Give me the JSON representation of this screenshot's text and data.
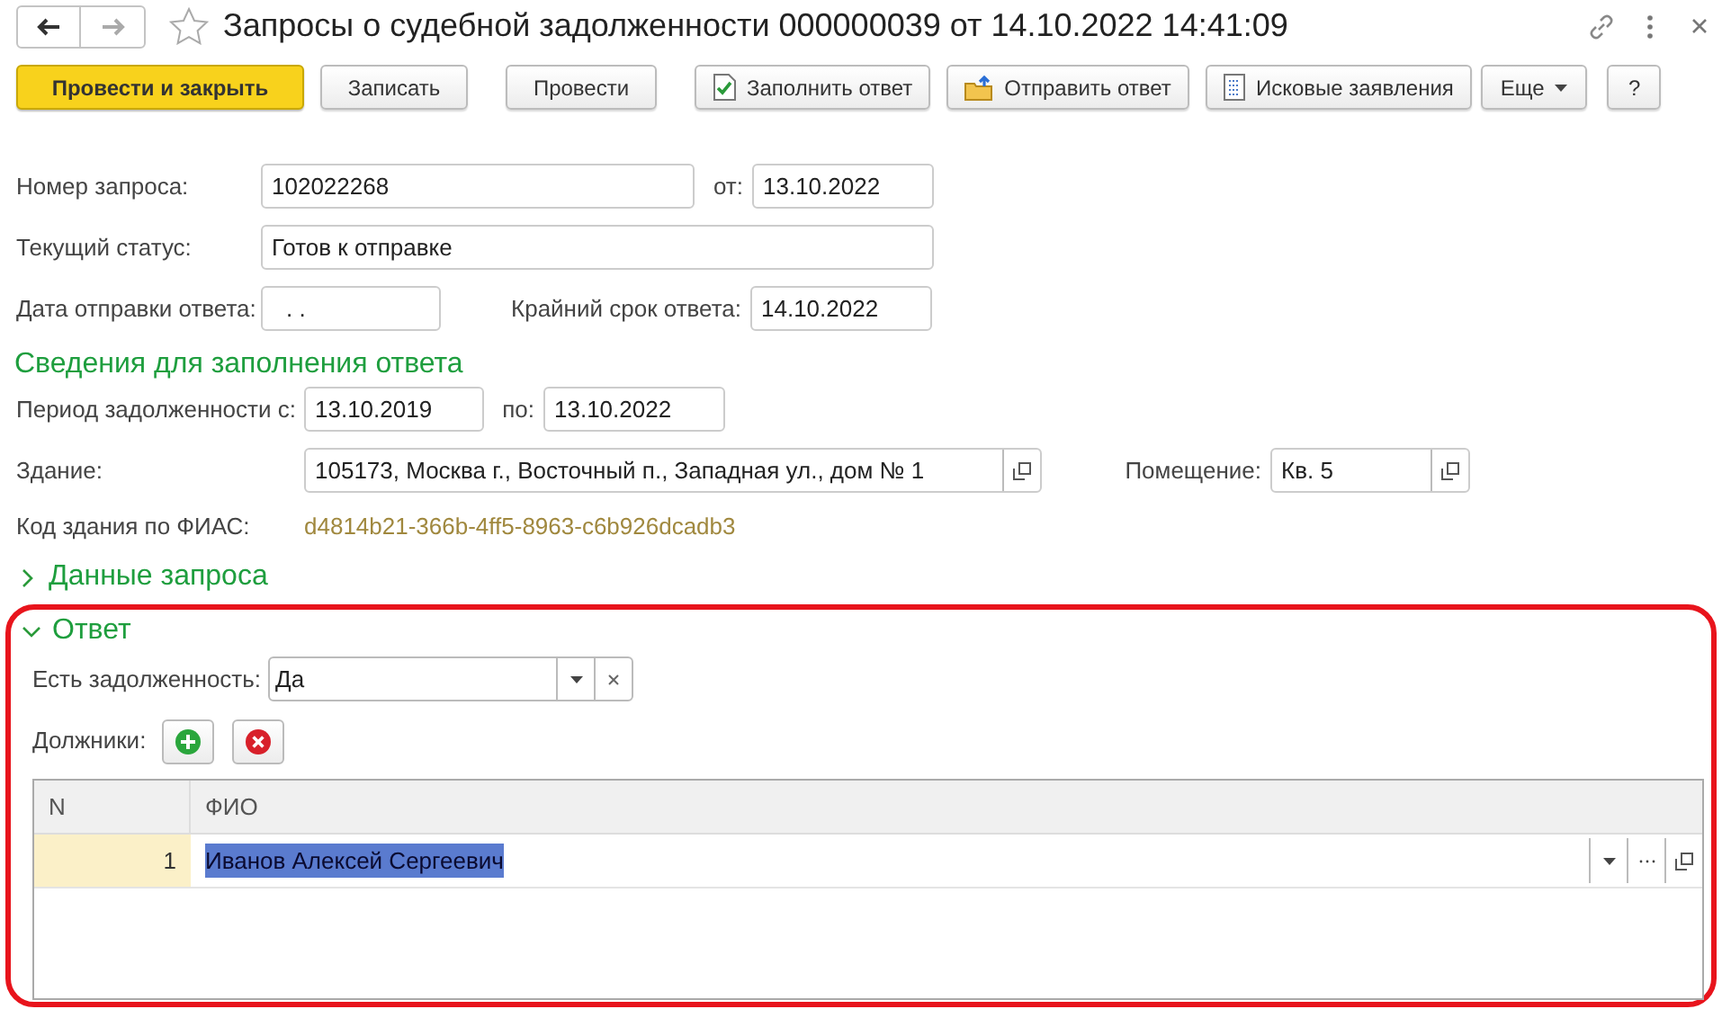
{
  "window": {
    "title": "Запросы о судебной задолженности 000000039 от 14.10.2022 14:41:09",
    "favorite": false
  },
  "toolbar": [
    {
      "label": "Провести и закрыть",
      "kind": "primary"
    },
    {
      "label": "Записать",
      "kind": "plain"
    },
    {
      "label": "Провести",
      "kind": "plain"
    },
    {
      "label": "Заполнить ответ",
      "kind": "fill"
    },
    {
      "label": "Отправить ответ",
      "kind": "send"
    },
    {
      "label": "Исковые заявления",
      "kind": "claims"
    },
    {
      "label": "Еще",
      "kind": "more"
    },
    {
      "label": "?",
      "kind": "help"
    }
  ],
  "request": {
    "number_label": "Номер запроса:",
    "number": "102022268",
    "date_label": "от:",
    "date": "13.10.2022",
    "status_label": "Текущий статус:",
    "status": "Готов к отправке",
    "sent_label": "Дата отправки ответа:",
    "sent": ". .",
    "deadline_label": "Крайний срок ответа:",
    "deadline": "14.10.2022"
  },
  "details": {
    "title": "Сведения для заполнения ответа",
    "period_label": "Период задолженности с:",
    "period_from": "13.10.2019",
    "to_label": "по:",
    "period_to": "13.10.2022",
    "building_label": "Здание:",
    "building": "105173, Москва г., Восточный п., Западная ул., дом № 1",
    "room_label": "Помещение:",
    "room": "Кв. 5",
    "fias_label": "Код здания по ФИАС:",
    "fias": "d4814b21-366b-4ff5-8963-c6b926dcadb3"
  },
  "request_data": {
    "title": "Данные запроса",
    "expanded": false
  },
  "answer": {
    "title": "Ответ",
    "expanded": true,
    "debt_label": "Есть задолженность:",
    "debt": "Да",
    "debtors_label": "Должники:",
    "table": {
      "columns": [
        "N",
        "ФИО"
      ],
      "rows": [
        {
          "n": "1",
          "name": "Иванов Алексей Сергеевич",
          "selected": true
        }
      ]
    }
  }
}
